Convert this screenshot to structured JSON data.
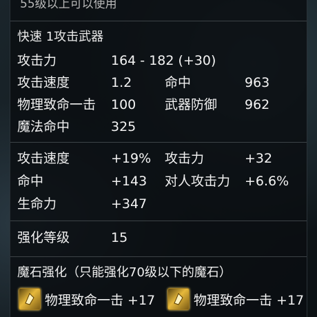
{
  "requirement": "55级以上可以使用",
  "weapon_type": "快速 1攻击武器",
  "base_stats": [
    {
      "label": "攻击力",
      "value": "164 - 182 (+30)"
    },
    {
      "label": "攻击速度",
      "value": "1.2",
      "label2": "命中",
      "value2": "963"
    },
    {
      "label": "物理致命一击",
      "value": "100",
      "label2": "武器防御",
      "value2": "962"
    },
    {
      "label": "魔法命中",
      "value": "325"
    }
  ],
  "bonus_stats": [
    {
      "label": "攻击速度",
      "value": "+19%",
      "label2": "攻击力",
      "value2": "+32"
    },
    {
      "label": "命中",
      "value": "+143",
      "label2": "对人攻击力",
      "value2": "+6.6%"
    },
    {
      "label": "生命力",
      "value": "+347"
    }
  ],
  "enhance": {
    "label": "强化等级",
    "value": "15"
  },
  "manastone": {
    "title": "魔石强化（只能强化70级以下的魔石）",
    "slots": [
      {
        "icon": "manastone-icon",
        "text": "物理致命一击 +17"
      },
      {
        "icon": "manastone-icon",
        "text": "物理致命一击 +17"
      }
    ]
  },
  "colors": {
    "text": "#f2f2f2",
    "gem": "#e7b93b",
    "separator": "#3d4347"
  }
}
